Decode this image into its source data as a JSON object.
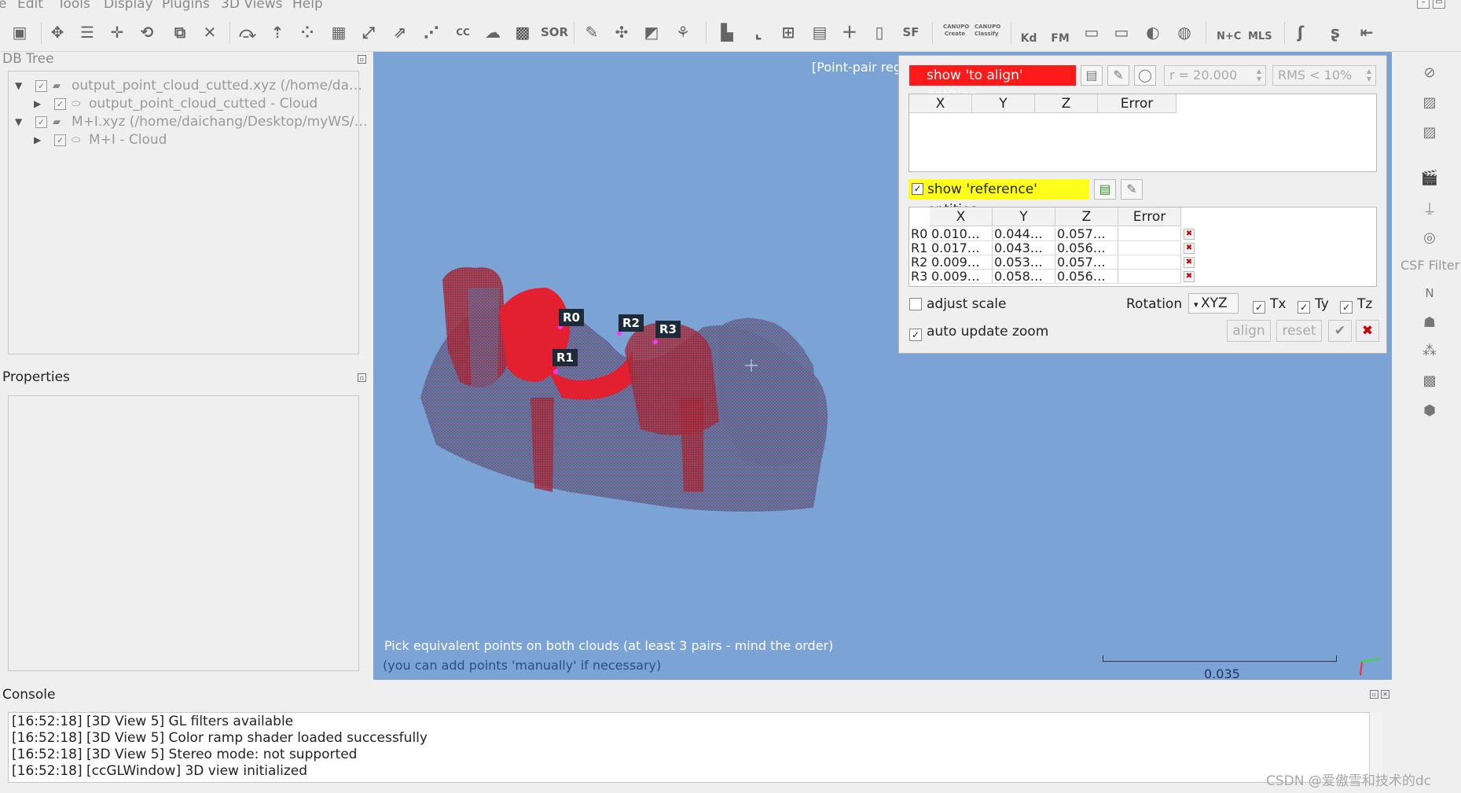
{
  "menu": [
    "e",
    "Edit",
    "Tools",
    "Display",
    "Plugins",
    "3D Views",
    "Help"
  ],
  "toolbar_icons": [
    "save-icon",
    "settings-icon",
    "list-icon",
    "translate-icon",
    "rotate-icon",
    "clone-icon",
    "delete-icon",
    "merge-icon",
    "subsample-icon",
    "sample-icon",
    "noise-icon",
    "normals-icon",
    "scale-icon",
    "segment-icon",
    "cc-icon",
    "cloud-icon",
    "checker-icon",
    "sor-icon",
    "pick-icon",
    "move-icon",
    "plane-icon",
    "filter-icon",
    "histogram-icon",
    "curve-icon",
    "max-icon",
    "stat-icon",
    "plus-icon",
    "doc-icon",
    "sf-icon",
    "canupo-create-icon",
    "canupo-classify-icon",
    "kd-icon",
    "fm-icon",
    "cam-icon",
    "ground-icon",
    "sphere-icon",
    "globe-icon",
    "nc-icon",
    "mls-icon",
    "s-icon",
    "ss-icon",
    "exit-icon"
  ],
  "toolbar_text": {
    "sor": "SOR",
    "cc": "CC",
    "sf": "SF",
    "kd": "Kd",
    "fm": "FM",
    "nc": "N+C",
    "mls": "MLS",
    "canupo1": "CANUPO",
    "canupo2": "CANUPO",
    "create": "Create",
    "classify": "Classify"
  },
  "db_tree": {
    "title": "DB Tree",
    "items": [
      {
        "label": "output_point_cloud_cutted.xyz (/home/da…",
        "level": 0,
        "expanded": true
      },
      {
        "label": "output_point_cloud_cutted - Cloud",
        "level": 1,
        "expanded": false
      },
      {
        "label": "M+I.xyz (/home/daichang/Desktop/myWS/…",
        "level": 0,
        "expanded": true
      },
      {
        "label": "M+I - Cloud",
        "level": 1,
        "expanded": false
      }
    ]
  },
  "properties": {
    "title": "Properties"
  },
  "view": {
    "title": "[Point-pair reg",
    "message_line1": "Pick equivalent points on both clouds (at least 3 pairs - mind the order)",
    "message_line2": "(you can add points 'manually' if necessary)",
    "scale_value": "0.035",
    "point_labels": [
      "R0",
      "R1",
      "R2",
      "R3"
    ]
  },
  "dialog": {
    "align_button": "show 'to align' entities",
    "radius_placeholder": "r = 20.000",
    "rms_placeholder": "RMS < 10%",
    "align_table_headers": [
      "X",
      "Y",
      "Z",
      "Error"
    ],
    "reference_button": "show 'reference' entities",
    "ref_table_headers": [
      "X",
      "Y",
      "Z",
      "Error"
    ],
    "ref_rows": [
      {
        "id": "R0",
        "x": "0.010…",
        "y": "0.044…",
        "z": "0.057…",
        "error": ""
      },
      {
        "id": "R1",
        "x": "0.017…",
        "y": "0.043…",
        "z": "0.056…",
        "error": ""
      },
      {
        "id": "R2",
        "x": "0.009…",
        "y": "0.053…",
        "z": "0.057…",
        "error": ""
      },
      {
        "id": "R3",
        "x": "0.009…",
        "y": "0.058…",
        "z": "0.056…",
        "error": ""
      }
    ],
    "adjust_scale": "adjust scale",
    "rotation_label": "Rotation",
    "rotation_value": "XYZ",
    "tx": "Tx",
    "ty": "Ty",
    "tz": "Tz",
    "auto_update_zoom": "auto update zoom",
    "align_btn": "align",
    "reset_btn": "reset"
  },
  "right_toolbar": {
    "csf_filter": "CSF Filter",
    "n_label": "N"
  },
  "console": {
    "title": "Console",
    "lines": [
      "[16:52:18] [3D View 5] GL filters available",
      "[16:52:18] [3D View 5] Color ramp shader loaded successfully",
      "[16:52:18] [3D View 5] Stereo mode: not supported",
      "[16:52:18] [ccGLWindow] 3D view initialized"
    ]
  },
  "watermark": "CSDN @爱傲雪和技术的dc",
  "colors": {
    "view_bg": "#7ba3d5",
    "red_button": "#ff1a1a",
    "yellow_button": "#ffff1a",
    "point_marker": "#ff33ff"
  }
}
